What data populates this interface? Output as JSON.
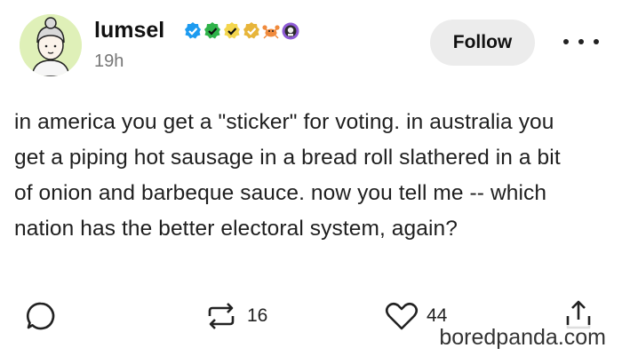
{
  "post": {
    "username": "lumsel",
    "timestamp": "19h",
    "follow_label": "Follow",
    "more_icon": "more-dots-icon",
    "badges": [
      {
        "icon": "verified-badge-blue",
        "color": "#1d9bf0"
      },
      {
        "icon": "verified-badge-green",
        "color": "#2fb34a"
      },
      {
        "icon": "verified-badge-yellow",
        "color": "#f2c744"
      },
      {
        "icon": "verified-badge-gold",
        "color": "#e7b53a"
      },
      {
        "icon": "crab-badge",
        "color": "#f08a3c"
      },
      {
        "icon": "purple-creature-badge",
        "color": "#8e5bd6"
      }
    ],
    "body_lines": [
      "in america you get a \"sticker\" for voting. in australia you",
      "get a piping hot sausage in a bread roll slathered in a bit",
      "of onion and barbeque sauce. now you tell me -- which",
      "nation has the better electoral system, again?"
    ]
  },
  "actions": {
    "reply_icon": "comment-bubble-icon",
    "reblog_icon": "reblog-icon",
    "reblog_count": "16",
    "like_icon": "heart-icon",
    "like_count": "44",
    "share_icon": "share-icon"
  },
  "watermark": "boredpanda.com",
  "colors": {
    "background": "#ffffff",
    "follow_bg": "#ececec",
    "avatar_bg": "#dff0b8"
  }
}
